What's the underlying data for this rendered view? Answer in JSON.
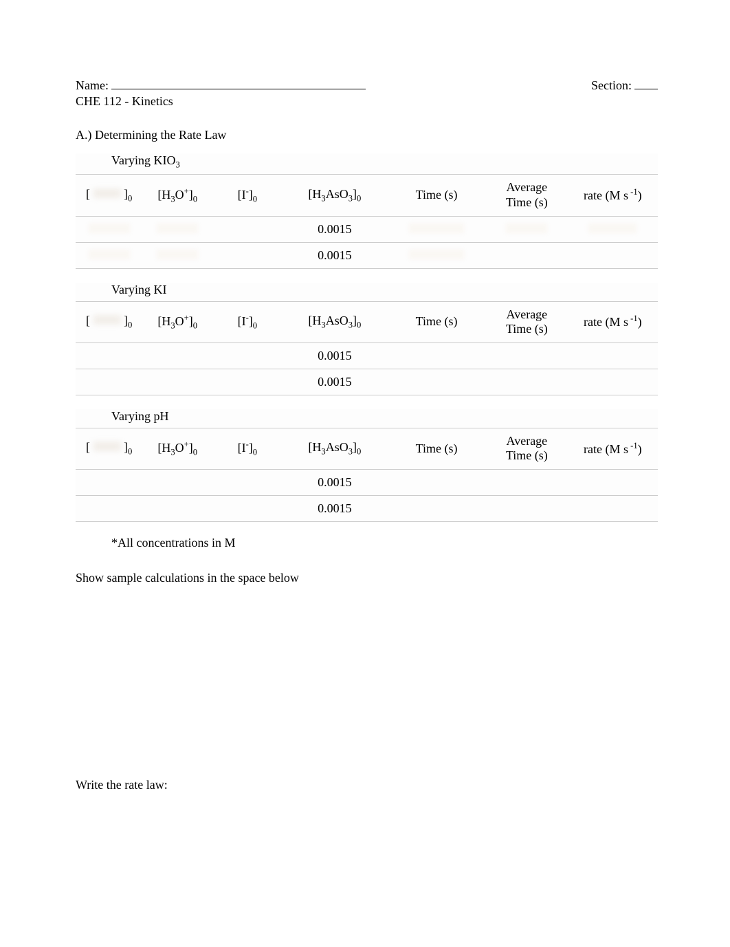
{
  "header": {
    "name_label": "Name:",
    "section_label": "Section:",
    "course": "CHE 112 - Kinetics"
  },
  "section_a": {
    "title": "A.) Determining the Rate Law"
  },
  "columns": {
    "bracket_open": "[",
    "bracket_close_sub0": "]",
    "h3o": "[H",
    "h3o_tail": "O",
    "h3o_end": "]",
    "i_col": "[I",
    "i_col_end": "]",
    "h3aso3": "[H",
    "h3aso3_mid": "AsO",
    "h3aso3_end": "]",
    "time": "Time (s)",
    "avg_time_l1": "Average",
    "avg_time_l2": "Time (s)",
    "rate_pre": "rate (M s",
    "rate_post": ")"
  },
  "tables": [
    {
      "title_pre": "Varying KIO",
      "title_sub": "3",
      "rows": [
        {
          "h3aso3": "0.0015"
        },
        {
          "h3aso3": "0.0015"
        }
      ]
    },
    {
      "title_pre": "Varying KI",
      "title_sub": "",
      "rows": [
        {
          "h3aso3": "0.0015"
        },
        {
          "h3aso3": "0.0015"
        }
      ]
    },
    {
      "title_pre": "Varying pH",
      "title_sub": "",
      "rows": [
        {
          "h3aso3": "0.0015"
        },
        {
          "h3aso3": "0.0015"
        }
      ]
    }
  ],
  "note": "*All concentrations in M",
  "calc_prompt": "Show sample calculations in the space below",
  "rate_prompt": "Write the rate law:"
}
